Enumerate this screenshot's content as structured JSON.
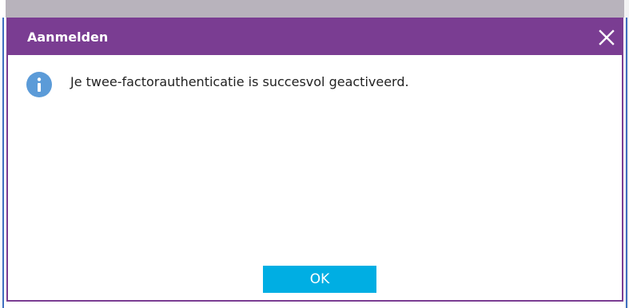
{
  "dialog": {
    "title": "Aanmelden",
    "message": "Je twee-factorauthenticatie is succesvol geactiveerd.",
    "ok_label": "OK",
    "close_icon": "close-icon",
    "info_icon": "info-icon"
  },
  "colors": {
    "titlebar": "#7a3d92",
    "info_icon": "#5b9bd8",
    "ok_button": "#00aee3",
    "background_strip": "#b8b3bc"
  }
}
